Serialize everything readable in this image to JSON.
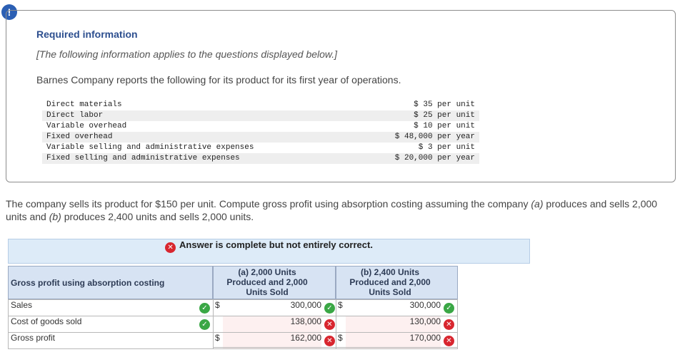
{
  "alert_icon": "!",
  "info": {
    "title": "Required information",
    "subtitle": "[The following information applies to the questions displayed below.]",
    "intro": "Barnes Company reports the following for its product for its first year of operations.",
    "costs": [
      {
        "label": "Direct materials",
        "value": "$ 35 per unit"
      },
      {
        "label": "Direct labor",
        "value": "$ 25 per unit"
      },
      {
        "label": "Variable overhead",
        "value": "$ 10 per unit"
      },
      {
        "label": "Fixed overhead",
        "value": "$ 48,000 per year"
      },
      {
        "label": "Variable selling and administrative expenses",
        "value": "$ 3 per unit"
      },
      {
        "label": "Fixed selling and administrative expenses",
        "value": "$ 20,000 per year"
      }
    ]
  },
  "question": {
    "part1": "The company sells its product for $150 per unit. Compute gross profit using absorption costing assuming the company ",
    "a_mark": "(a)",
    "part2": " produces and sells 2,000 units and ",
    "b_mark": "(b)",
    "part3": " produces 2,400 units and sells 2,000 units."
  },
  "banner": {
    "text": "Answer is complete but not entirely correct."
  },
  "answer_table": {
    "header_label": "Gross profit using absorption costing",
    "col_a": [
      "(a) 2,000 Units",
      "Produced and 2,000",
      "Units Sold"
    ],
    "col_b": [
      "(b) 2,400 Units",
      "Produced and 2,000",
      "Units Sold"
    ],
    "rows": [
      {
        "label": "Sales",
        "a_dollar": "$",
        "a_value": "300,000",
        "a_status": "correct",
        "b_dollar": "$",
        "b_value": "300,000",
        "b_status": "correct",
        "row_check": true
      },
      {
        "label": "Cost of goods sold",
        "a_dollar": "",
        "a_value": "138,000",
        "a_status": "incorrect",
        "b_dollar": "",
        "b_value": "130,000",
        "b_status": "incorrect",
        "row_check": true
      },
      {
        "label": "Gross profit",
        "a_dollar": "$",
        "a_value": "162,000",
        "a_status": "incorrect",
        "b_dollar": "$",
        "b_value": "170,000",
        "b_status": "incorrect",
        "row_check": false
      }
    ]
  },
  "colors": {
    "correct": "#3aa745",
    "incorrect": "#d8262f",
    "header_bg": "#d7e3f3",
    "banner_bg": "#ddebf8"
  }
}
